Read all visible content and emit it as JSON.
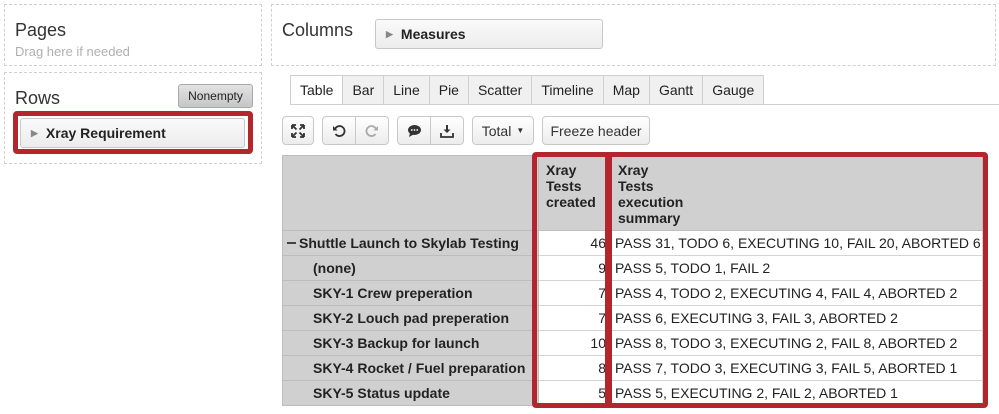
{
  "pages": {
    "title": "Pages",
    "hint": "Drag here if needed"
  },
  "rows": {
    "title": "Rows",
    "nonempty_label": "Nonempty",
    "item": "Xray Requirement"
  },
  "columns": {
    "title": "Columns",
    "item": "Measures"
  },
  "tabs": [
    "Table",
    "Bar",
    "Line",
    "Pie",
    "Scatter",
    "Timeline",
    "Map",
    "Gantt",
    "Gauge"
  ],
  "active_tab": "Table",
  "toolbar": {
    "total_label": "Total",
    "freeze_label": "Freeze header"
  },
  "table": {
    "headers": [
      [
        "Xray",
        "Tests",
        "created"
      ],
      [
        "Xray",
        "Tests",
        "execution",
        "summary"
      ]
    ],
    "rows": [
      {
        "label": "Shuttle Launch to Skylab Testing",
        "created": "46",
        "summary": "PASS 31, TODO 6, EXECUTING 10, FAIL 20, ABORTED 6",
        "expanded": true
      },
      {
        "label": "(none)",
        "created": "9",
        "summary": "PASS 5, TODO 1, FAIL 2"
      },
      {
        "label": "SKY-1 Crew preperation",
        "created": "7",
        "summary": "PASS 4, TODO 2, EXECUTING 4, FAIL 4, ABORTED 2"
      },
      {
        "label": "SKY-2 Louch pad preperation",
        "created": "7",
        "summary": "PASS 6, EXECUTING 3, FAIL 3, ABORTED 2"
      },
      {
        "label": "SKY-3 Backup for launch",
        "created": "10",
        "summary": "PASS 8, TODO 3, EXECUTING 2, FAIL 8, ABORTED 2"
      },
      {
        "label": "SKY-4 Rocket / Fuel preparation",
        "created": "8",
        "summary": "PASS 7, TODO 3, EXECUTING 3, FAIL 5, ABORTED 1"
      },
      {
        "label": "SKY-5 Status update",
        "created": "5",
        "summary": "PASS 5, EXECUTING 2, FAIL 2, ABORTED 1"
      }
    ]
  },
  "highlight_color": "#b3262e"
}
